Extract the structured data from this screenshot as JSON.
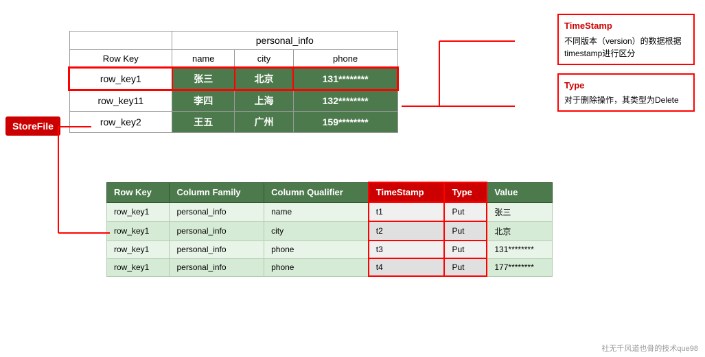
{
  "storefile": {
    "label": "StoreFile"
  },
  "annotations": {
    "timestamp": {
      "title": "TimeStamp",
      "text": "不同版本（version）的数据根据timestamp进行区分"
    },
    "type": {
      "title": "Type",
      "text": "对于删除操作，其类型为Delete"
    }
  },
  "top_table": {
    "column_family": "personal_info",
    "headers": [
      "Row Key",
      "name",
      "city",
      "phone"
    ],
    "rows": [
      {
        "key": "row_key1",
        "name": "张三",
        "city": "北京",
        "phone": "131********"
      },
      {
        "key": "row_key11",
        "name": "李四",
        "city": "上海",
        "phone": "132********"
      },
      {
        "key": "row_key2",
        "name": "王五",
        "city": "广州",
        "phone": "159********"
      }
    ]
  },
  "bottom_table": {
    "headers": [
      "Row Key",
      "Column Family",
      "Column Qualifier",
      "TimeStamp",
      "Type",
      "Value"
    ],
    "rows": [
      {
        "row_key": "row_key1",
        "col_family": "personal_info",
        "col_qualifier": "name",
        "timestamp": "t1",
        "type": "Put",
        "value": "张三"
      },
      {
        "row_key": "row_key1",
        "col_family": "personal_info",
        "col_qualifier": "city",
        "timestamp": "t2",
        "type": "Put",
        "value": "北京"
      },
      {
        "row_key": "row_key1",
        "col_family": "personal_info",
        "col_qualifier": "phone",
        "timestamp": "t3",
        "type": "Put",
        "value": "131********"
      },
      {
        "row_key": "row_key1",
        "col_family": "personal_info",
        "col_qualifier": "phone",
        "timestamp": "t4",
        "type": "Put",
        "value": "177********"
      }
    ]
  },
  "watermark": {
    "text": "社无千风道也骨的技术que98"
  }
}
